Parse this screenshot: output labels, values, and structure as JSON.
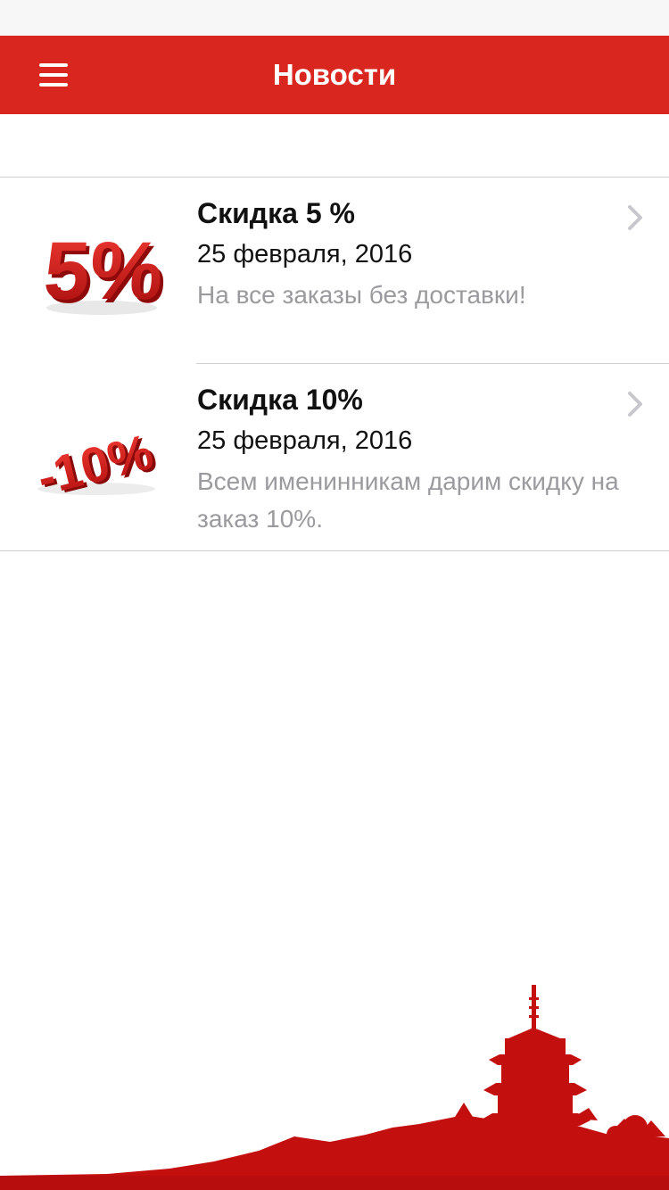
{
  "header": {
    "title": "Новости",
    "menu_icon": "hamburger-menu-icon"
  },
  "news": [
    {
      "title": "Скидка 5 %",
      "date": "25 февраля, 2016",
      "description": "На все заказы без доставки!",
      "badge_text": "5%"
    },
    {
      "title": "Скидка 10%",
      "date": "25 февраля, 2016",
      "description": "Всем именинникам дарим скидку на заказ 10%.",
      "badge_text": "-10%"
    }
  ],
  "colors": {
    "accent": "#d9261f",
    "secondary_text": "#9a9a9f",
    "footer_red": "#c40f0f"
  }
}
